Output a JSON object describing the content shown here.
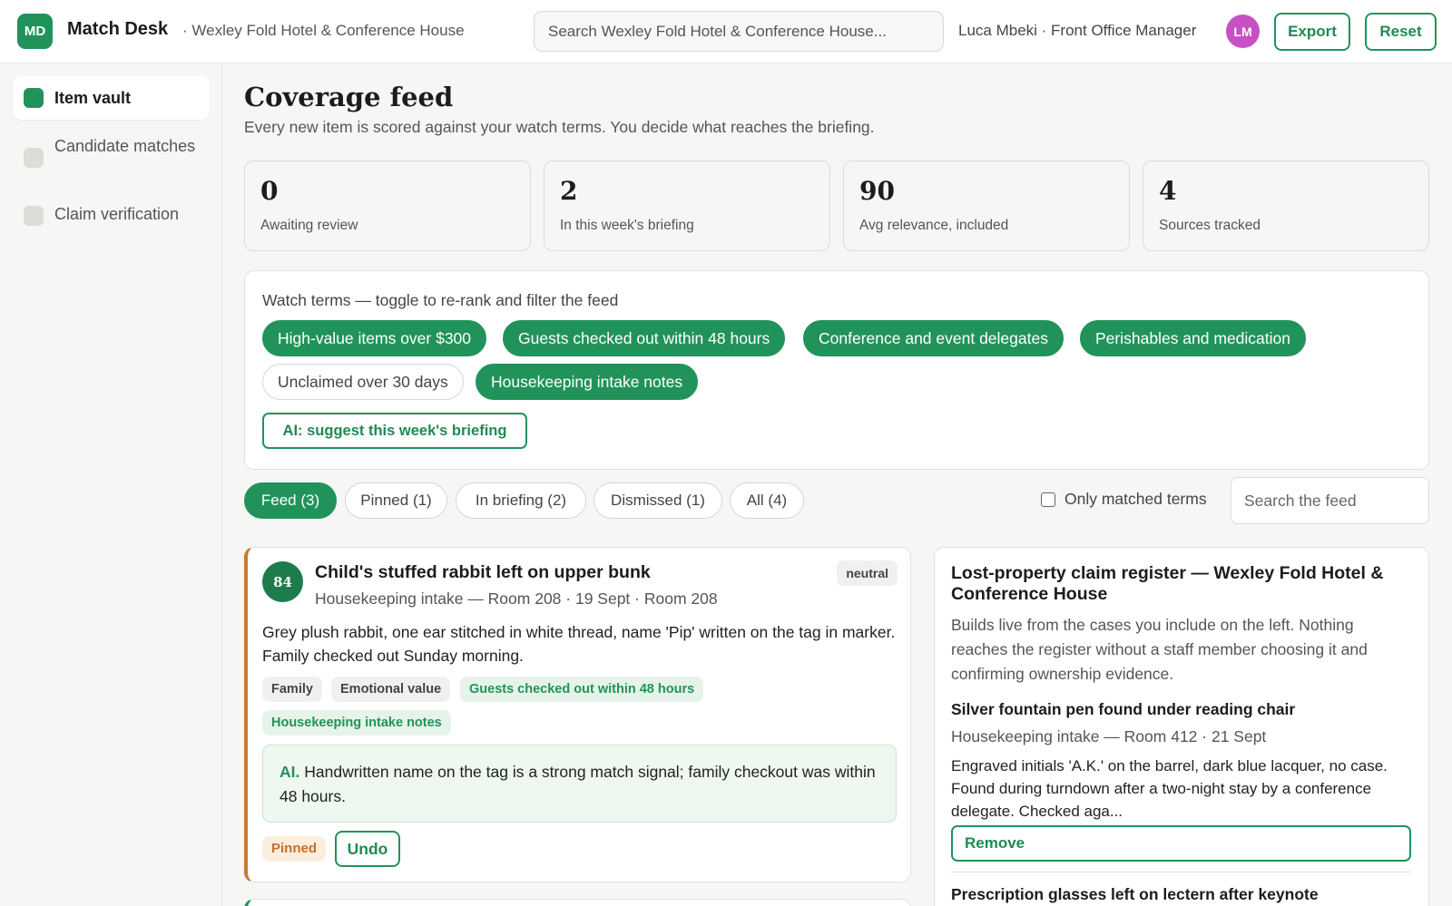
{
  "app": {
    "logo_initials": "MD",
    "name": "Match Desk",
    "property": "· Wexley Fold Hotel & Conference House",
    "search_placeholder": "Search Wexley Fold Hotel & Conference House...",
    "user": "Luca Mbeki · Front Office Manager",
    "avatar_initials": "LM",
    "export_label": "Export",
    "reset_label": "Reset",
    "accent_color": "#21935a"
  },
  "sidebar": {
    "items": [
      {
        "label": "Item vault",
        "active": true
      },
      {
        "label": "Candidate matches",
        "active": false
      },
      {
        "label": "Claim verification",
        "active": false
      }
    ]
  },
  "page": {
    "title": "Coverage feed",
    "subtitle": "Every new item is scored against your watch terms. You decide what reaches the briefing."
  },
  "stats": [
    {
      "value": "0",
      "label": "Awaiting review"
    },
    {
      "value": "2",
      "label": "In this week's briefing"
    },
    {
      "value": "90",
      "label": "Avg relevance, included"
    },
    {
      "value": "4",
      "label": "Sources tracked"
    }
  ],
  "watch": {
    "title": "Watch terms — toggle to re-rank and filter the feed",
    "terms": [
      {
        "label": "High-value items over $300",
        "on": true
      },
      {
        "label": "Guests checked out within 48 hours",
        "on": true
      },
      {
        "label": "Conference and event delegates",
        "on": true
      },
      {
        "label": "Perishables and medication",
        "on": true
      },
      {
        "label": "Unclaimed over 30 days",
        "on": false
      },
      {
        "label": "Housekeeping intake notes",
        "on": true
      }
    ],
    "ai_button": "AI: suggest this week's briefing"
  },
  "tabs": [
    {
      "label": "Feed (3)",
      "active": true
    },
    {
      "label": "Pinned (1)",
      "active": false
    },
    {
      "label": "In briefing (2)",
      "active": false
    },
    {
      "label": "Dismissed (1)",
      "active": false
    },
    {
      "label": "All (4)",
      "active": false
    }
  ],
  "filters": {
    "only_matched_label": "Only matched terms",
    "only_matched_checked": false,
    "feed_search_placeholder": "Search the feed"
  },
  "feed": [
    {
      "score": "84",
      "title": "Child's stuffed rabbit left on upper bunk",
      "meta": "Housekeeping intake — Room 208 · 19 Sept · Room 208",
      "sentiment": "neutral",
      "body": "Grey plush rabbit, one ear stitched in white thread, name 'Pip' written on the tag in marker. Family checked out Sunday morning.",
      "tags": [
        "Family",
        "Emotional value"
      ],
      "matched_terms": [
        "Guests checked out within 48 hours",
        "Housekeeping intake notes"
      ],
      "ai_label": "AI.",
      "ai_note": "Handwritten name on the tag is a strong match signal; family checkout was within 48 hours.",
      "status": "Pinned",
      "undo_label": "Undo"
    }
  ],
  "register": {
    "title": "Lost-property claim register — Wexley Fold Hotel & Conference House",
    "description": "Builds live from the cases you include on the left. Nothing reaches the register without a staff member choosing it and confirming ownership evidence.",
    "items": [
      {
        "title": "Silver fountain pen found under reading chair",
        "meta": "Housekeeping intake — Room 412 · 21 Sept",
        "body": "Engraved initials 'A.K.' on the barrel, dark blue lacquer, no case. Found during turndown after a two-night stay by a conference delegate. Checked aga...",
        "remove_label": "Remove"
      },
      {
        "title": "Prescription glasses left on lectern after keynote"
      }
    ]
  }
}
